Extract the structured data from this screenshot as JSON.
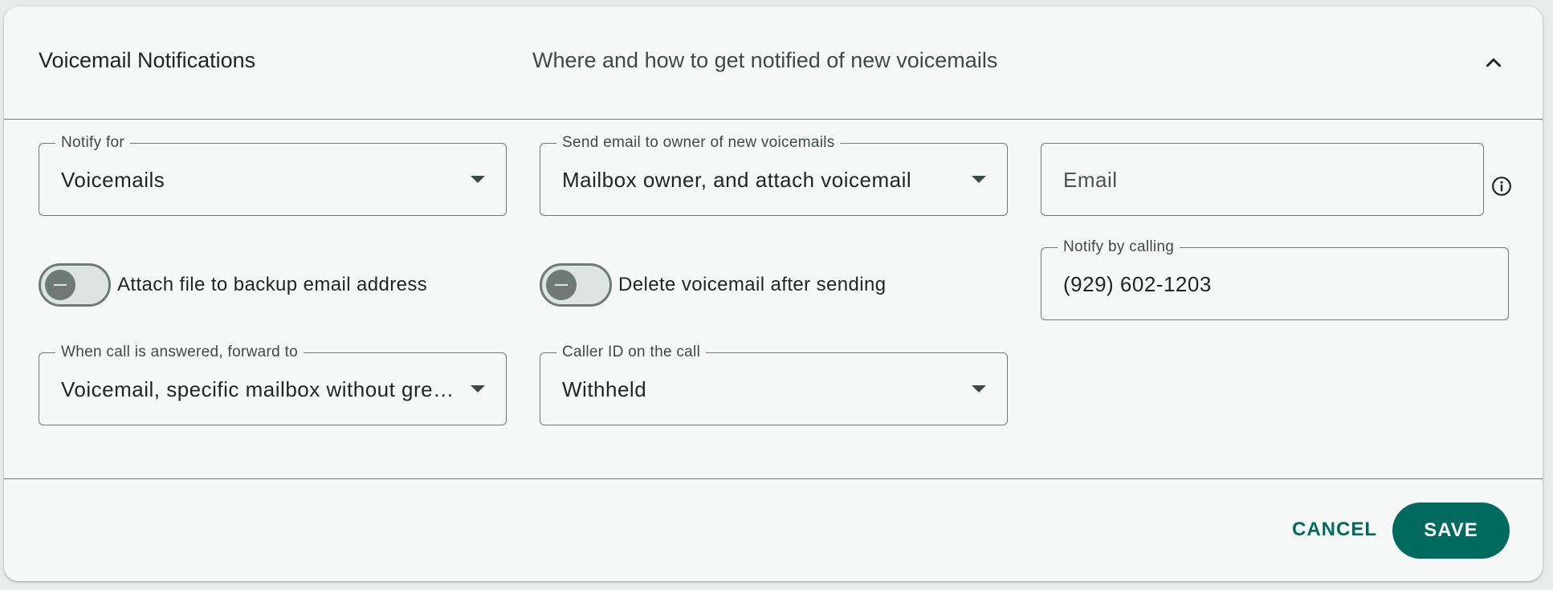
{
  "header": {
    "title": "Voicemail Notifications",
    "subtitle": "Where and how to get notified of new voicemails",
    "collapse_icon": "chevron-up-icon"
  },
  "fields": {
    "notify_for": {
      "label": "Notify for",
      "value": "Voicemails"
    },
    "send_email_to": {
      "label": "Send email to owner of new voicemails",
      "value": "Mailbox owner, and attach voicemail"
    },
    "email": {
      "placeholder": "Email",
      "value": "",
      "info_icon": "info-icon"
    },
    "notify_by_calling": {
      "label": "Notify by calling",
      "value": "(929) 602-1203"
    },
    "forward_to": {
      "label": "When call is answered, forward to",
      "value": "Voicemail, specific mailbox without greeting"
    },
    "caller_id": {
      "label": "Caller ID on the call",
      "value": "Withheld"
    }
  },
  "toggles": {
    "attach_backup": {
      "label": "Attach file to backup email address",
      "checked": false
    },
    "delete_after_sending": {
      "label": "Delete voicemail after sending",
      "checked": false
    }
  },
  "actions": {
    "cancel_label": "CANCEL",
    "save_label": "SAVE"
  },
  "colors": {
    "accent": "#006a5f",
    "outline": "#6f7975",
    "surface": "#f6f8f7"
  }
}
